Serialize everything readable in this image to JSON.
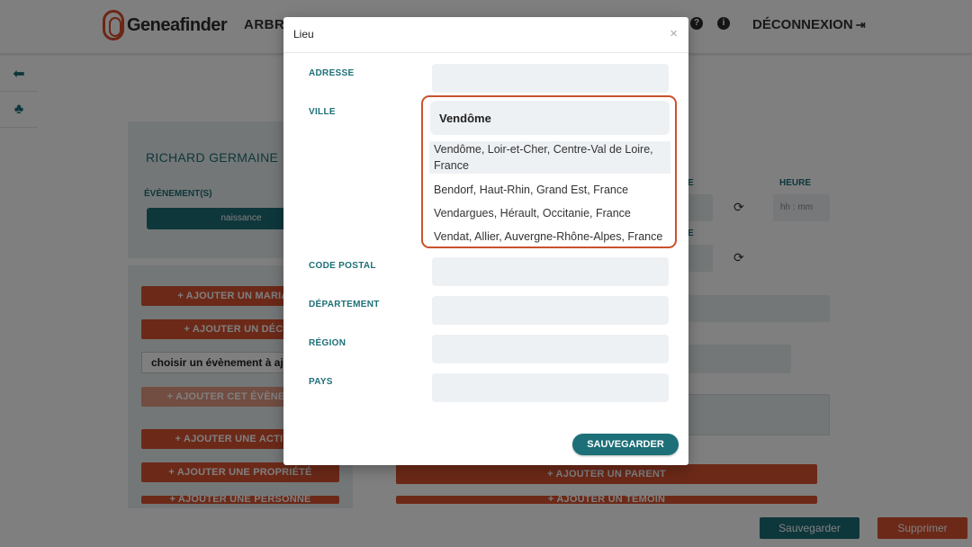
{
  "header": {
    "logo_text": "Geneafinder",
    "nav_arbre": "ARBRE",
    "help_icon": "?",
    "info_icon": "i",
    "logout_label": "DÉCONNEXION"
  },
  "side_nav": {
    "back_icon": "arrow-left-icon",
    "tree_icon": "tree-icon"
  },
  "background": {
    "person_name": "RICHARD GERMAINE",
    "events_label": "ÉVÉNEMENT(S)",
    "event_pill": "naissance",
    "btn_add_mariage": "+ AJOUTER UN MARIAGE",
    "btn_add_deces": "+ AJOUTER UN DÉCÈS",
    "choose_event": "choisir un évènement à ajouter",
    "btn_add_event": "+ AJOUTER CET ÉVÈNEMENT",
    "btn_add_activite": "+ AJOUTER UNE ACTIVITÉ",
    "btn_add_propriete": "+ AJOUTER UNE PROPRIÉTÉ",
    "btn_add_personne": "+ AJOUTER UNE PERSONNE",
    "lbl_e1": "E",
    "lbl_e2": "E",
    "lbl_heure": "HEURE",
    "time_placeholder": "hh : mm",
    "btn_add_parent": "+ AJOUTER UN PARENT",
    "btn_add_temoin": "+ AJOUTER UN TÉMOIN"
  },
  "footer": {
    "save_label": "Sauvegarder",
    "delete_label": "Supprimer"
  },
  "modal": {
    "title": "Lieu",
    "close": "×",
    "adresse_label": "ADRESSE",
    "adresse_value": "",
    "ville_label": "VILLE",
    "ville_value": "Vendôme",
    "suggestions": [
      "Vendôme, Loir-et-Cher, Centre-Val de Loire, France",
      "Bendorf, Haut-Rhin, Grand Est, France",
      "Vendargues, Hérault, Occitanie, France",
      "Vendat, Allier, Auvergne-Rhône-Alpes, France"
    ],
    "code_postal_label": "CODE POSTAL",
    "departement_label": "DÉPARTEMENT",
    "region_label": "RÉGION",
    "pays_label": "PAYS",
    "save_label": "SAUVEGARDER"
  },
  "colors": {
    "teal": "#1d6f78",
    "orange": "#d95230",
    "highlight": "#c9532c"
  }
}
